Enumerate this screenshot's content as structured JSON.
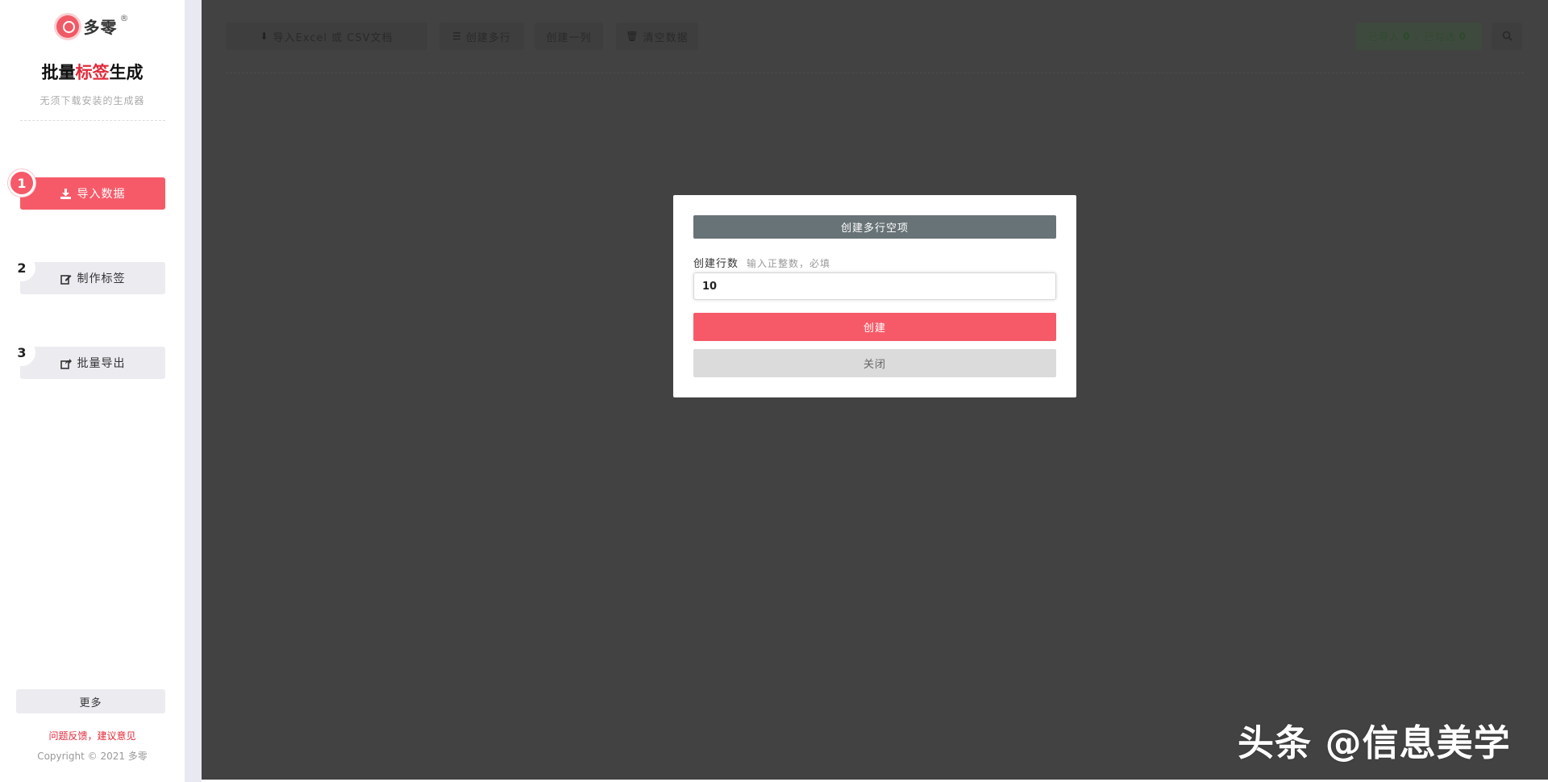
{
  "sidebar": {
    "brand_name": "多零",
    "brand_reg": "®",
    "title_part1": "批量",
    "title_accent": "标签",
    "title_part2": "生成",
    "subtitle": "无须下载安装的生成器",
    "steps": [
      {
        "num": "1",
        "label": "导入数据",
        "icon": "download-icon",
        "active": true
      },
      {
        "num": "2",
        "label": "制作标签",
        "icon": "edit-icon",
        "active": false
      },
      {
        "num": "3",
        "label": "批量导出",
        "icon": "share-icon",
        "active": false
      }
    ],
    "more_label": "更多",
    "feedback_label": "问题反馈，建议意见",
    "copyright": "Copyright © 2021 多零"
  },
  "toolbar": {
    "import_label": "导入Excel 或 CSV文档",
    "create_rows_label": "创建多行",
    "create_col_label": "创建一列",
    "clear_label": "清空数据",
    "status_imported_label": "已导入",
    "status_imported_count": "0",
    "status_sep": "，",
    "status_checked_label": "已勾选",
    "status_checked_count": "0",
    "search_icon": "search-icon"
  },
  "modal": {
    "title": "创建多行空项",
    "field_label": "创建行数",
    "field_hint": "输入正整数，必填",
    "field_value": "10",
    "create_label": "创建",
    "close_label": "关闭"
  },
  "watermark": "头条 @信息美学",
  "colors": {
    "accent": "#f65a68",
    "overlay": "#424242",
    "modal_header": "#687377"
  }
}
